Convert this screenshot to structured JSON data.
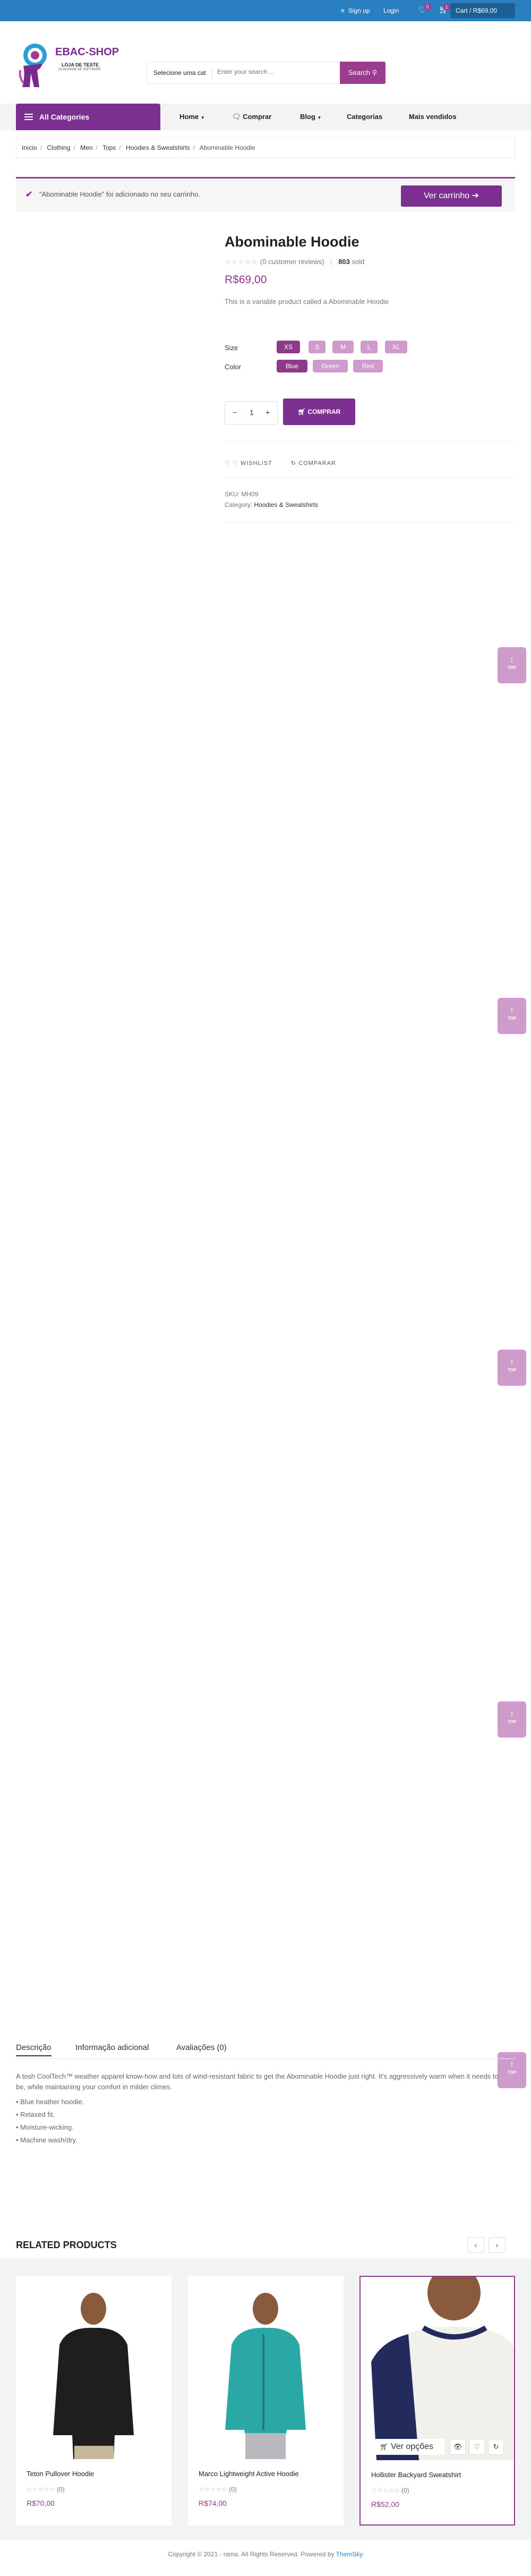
{
  "topbar": {
    "signup": "Sign up",
    "login": "Login",
    "wishlist_count": "0",
    "cart_count": "1",
    "cart_label": "Cart / R$69,00"
  },
  "logo": {
    "brand": "EBAC-SHOP",
    "tagline": "LOJA DE TESTE",
    "subtagline": "QUALIDADE DE SOFTWARE"
  },
  "search": {
    "category": "Selecione uma cat",
    "placeholder": "Enter your search ...",
    "button": "Search"
  },
  "nav": {
    "all_categories": "All Categories",
    "items": [
      "Home",
      "Comprar",
      "Blog",
      "Categorias",
      "Mais vendidos"
    ]
  },
  "breadcrumb": [
    "Início",
    "Clothing",
    "Men",
    "Tops",
    "Hoodies & Sweatshirts",
    "Abominable Hoodie"
  ],
  "notice": {
    "message": "“Abominable Hoodie” foi adicionado no seu carrinho.",
    "button": "Ver carrinho"
  },
  "product": {
    "title": "Abominable Hoodie",
    "reviews": "(0 customer reviews)",
    "sold_count": "803",
    "sold_label": "sold",
    "price": "R$69,00",
    "description": "This is a variable product called a Abominable Hoodie",
    "size_label": "Size",
    "sizes": [
      "XS",
      "S",
      "M",
      "L",
      "XL"
    ],
    "color_label": "Color",
    "colors": [
      "Blue",
      "Green",
      "Red"
    ],
    "quantity": "1",
    "buy_button": "COMPRAR",
    "wishlist": "WISHLIST",
    "compare": "COMPARAR",
    "sku_label": "SKU:",
    "sku": "MH09",
    "category_label": "Category:",
    "category": "Hoodies & Sweatshirts"
  },
  "totop_label": "TOP",
  "tabs": [
    "Descrição",
    "Informação adicional",
    "Avaliações (0)"
  ],
  "tab_content": {
    "text": "A tosh CoolTech™ weather apparel know-how and lots of wind-resistant fabric to get the Abominable Hoodie just right. It's aggressively warm when it needs to be, while maintaining your comfort in milder climes.",
    "bullets": [
      "Blue heather hoodie.",
      "Relaxed fit.",
      "Moisture-wicking.",
      "Machine wash/dry."
    ]
  },
  "related": {
    "title": "RELATED PRODUCTS",
    "products": [
      {
        "name": "Teton Pullover Hoodie",
        "reviews": "(0)",
        "price": "R$70,00"
      },
      {
        "name": "Marco Lightweight Active Hoodie",
        "reviews": "(0)",
        "price": "R$74,00"
      },
      {
        "name": "Hollister Backyard Sweatshirt",
        "reviews": "(0)",
        "price": "R$52,00"
      }
    ],
    "options_button": "Ver opções"
  },
  "footer": {
    "text": "Copyright © 2021 - rama. All Rights Reserved. Powered by",
    "link": "ThemSky"
  },
  "colors": {
    "accent": "#8e3a8a",
    "topbar": "#2a7fc1",
    "nav_purple": "#7b3090"
  }
}
